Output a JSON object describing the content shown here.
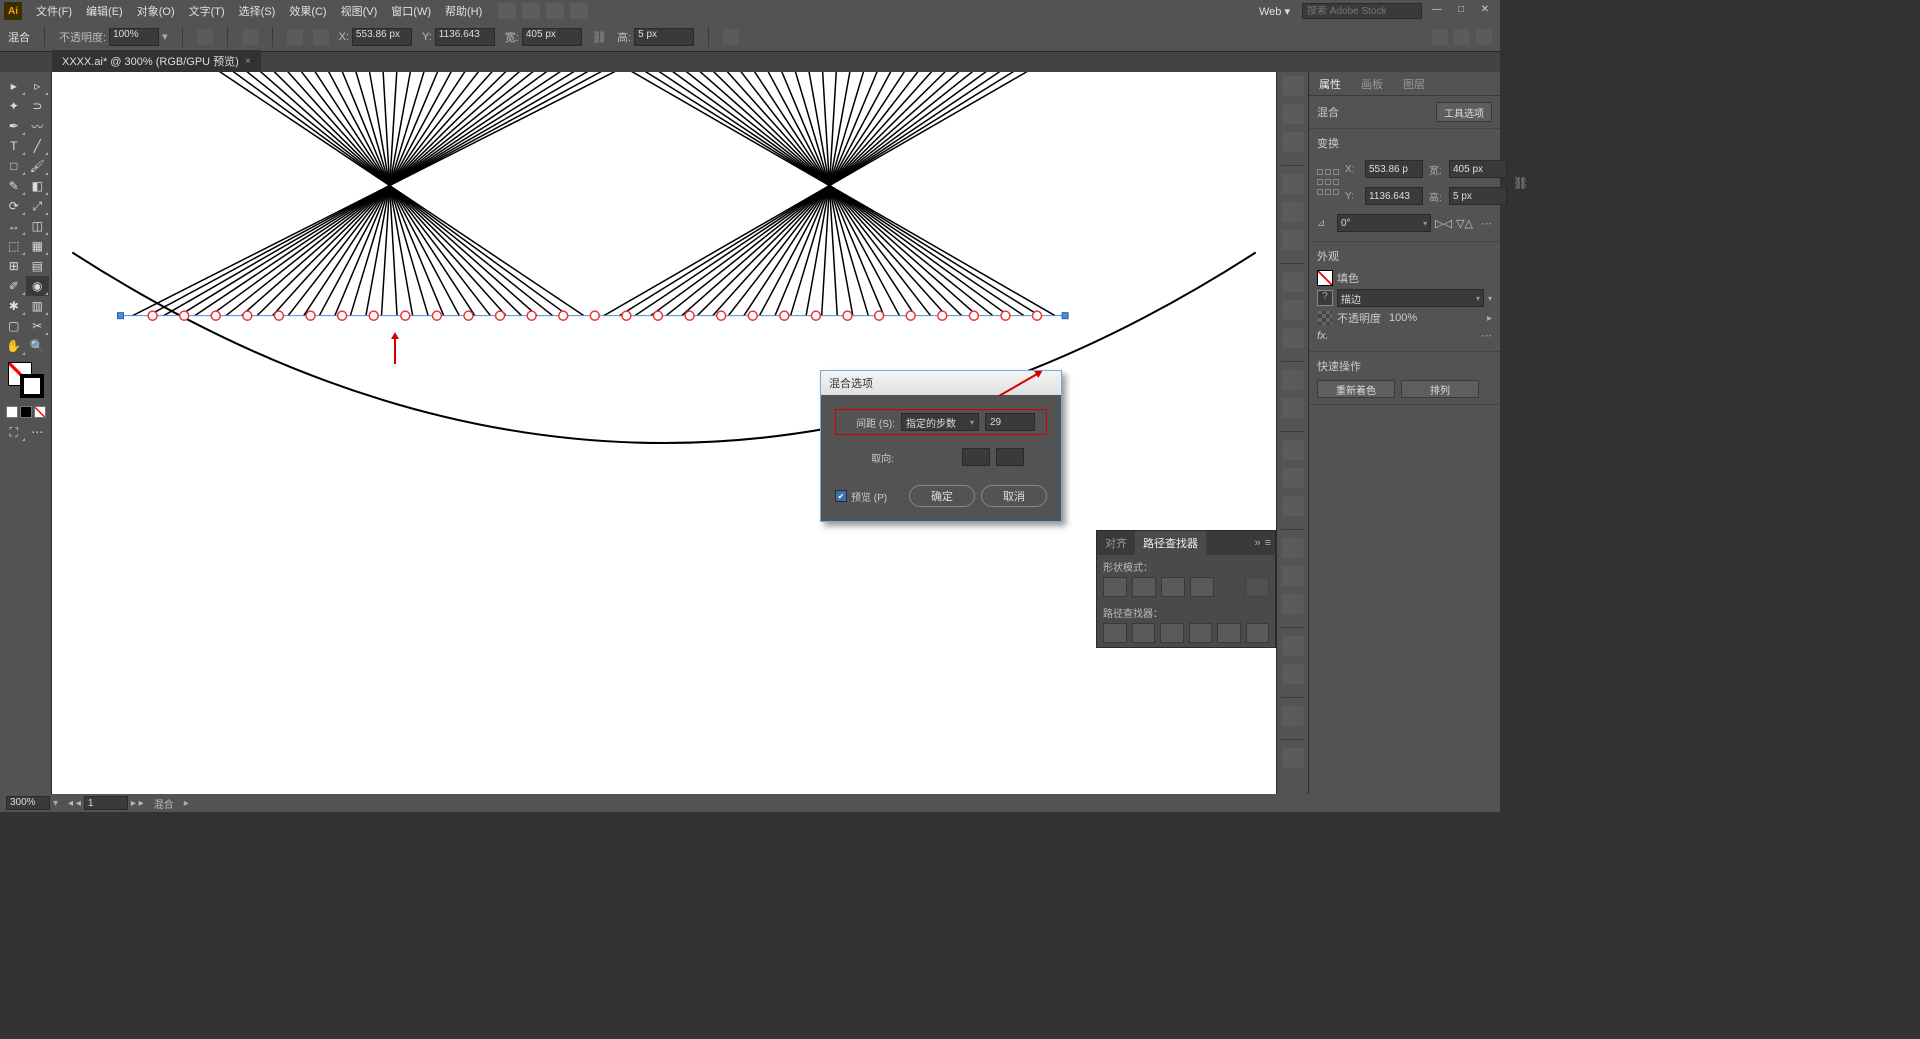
{
  "app": {
    "logo": "Ai"
  },
  "menubar": {
    "items": [
      "文件(F)",
      "编辑(E)",
      "对象(O)",
      "文字(T)",
      "选择(S)",
      "效果(C)",
      "视图(V)",
      "窗口(W)",
      "帮助(H)"
    ],
    "workspace": "Web",
    "search_placeholder": "搜索 Adobe Stock"
  },
  "controlbar": {
    "mode_label": "混合",
    "opacity_label": "不透明度:",
    "opacity_value": "100%",
    "x_label": "X:",
    "x_value": "553.86 px",
    "y_label": "Y:",
    "y_value": "1136.643",
    "w_label": "宽:",
    "w_value": "405 px",
    "h_label": "高:",
    "h_value": "5 px"
  },
  "tab": {
    "name": "XXXX.ai* @ 300% (RGB/GPU 预览)"
  },
  "statusbar": {
    "zoom": "300%",
    "nav_value": "1",
    "info": "混合"
  },
  "properties": {
    "tabs": [
      "属性",
      "画板",
      "图层"
    ],
    "object_type": "混合",
    "tool_options_label": "工具选项",
    "transform": {
      "title": "变换",
      "x": "553.86 p",
      "w": "405 px",
      "y": "1136.643",
      "h": "5 px",
      "angle": "0°"
    },
    "appearance": {
      "title": "外观",
      "fill_label": "填色",
      "stroke_label": "描边",
      "opacity_label": "不透明度",
      "opacity": "100%",
      "fx": "fx."
    },
    "quick": {
      "title": "快速操作",
      "recolor": "重新着色",
      "arrange": "排列"
    }
  },
  "pathfinder": {
    "tabs": [
      "对齐",
      "路径查找器"
    ],
    "shape_modes": "形状模式：",
    "pathfinders": "路径查找器："
  },
  "dialog": {
    "title": "混合选项",
    "spacing_label": "间距 (S):",
    "spacing_mode": "指定的步数",
    "spacing_value": "29",
    "orient_label": "取向:",
    "preview_label": "预览 (P)",
    "ok": "确定",
    "cancel": "取消"
  }
}
